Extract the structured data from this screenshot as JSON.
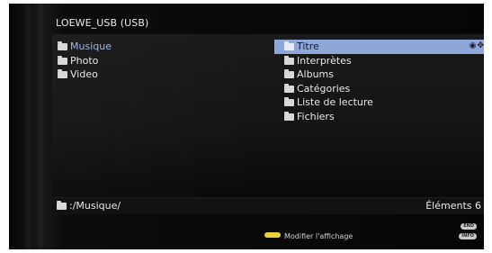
{
  "window": {
    "title": "LOEWE_USB (USB)"
  },
  "left_list": {
    "items": [
      {
        "label": "Musique",
        "icon": "folder-icon",
        "active": true
      },
      {
        "label": "Photo",
        "icon": "folder-icon",
        "active": false
      },
      {
        "label": "Video",
        "icon": "folder-icon",
        "active": false
      }
    ]
  },
  "right_list": {
    "items": [
      {
        "label": "Titre",
        "icon": "folder-icon",
        "selected": true
      },
      {
        "label": "Interprètes",
        "icon": "folder-icon",
        "selected": false
      },
      {
        "label": "Albums",
        "icon": "folder-icon",
        "selected": false
      },
      {
        "label": "Catégories",
        "icon": "folder-icon",
        "selected": false
      },
      {
        "label": "Liste de lecture",
        "icon": "folder-icon",
        "selected": false
      },
      {
        "label": "Fichiers",
        "icon": "folder-icon",
        "selected": false
      }
    ],
    "selected_row_icons": [
      "ok-icon",
      "navigation-arrows-icon"
    ]
  },
  "status_bar": {
    "path": ":/Musique/",
    "count_label": "Éléments 6"
  },
  "footer": {
    "hint": "Modifier l'affichage",
    "hint_key_color": "#e6d23a",
    "end_key": "END",
    "info_key": "INFO"
  },
  "colors": {
    "selection": "#8fa6d8",
    "active_text": "#9fb6e8",
    "background": "#0a0a0a"
  }
}
